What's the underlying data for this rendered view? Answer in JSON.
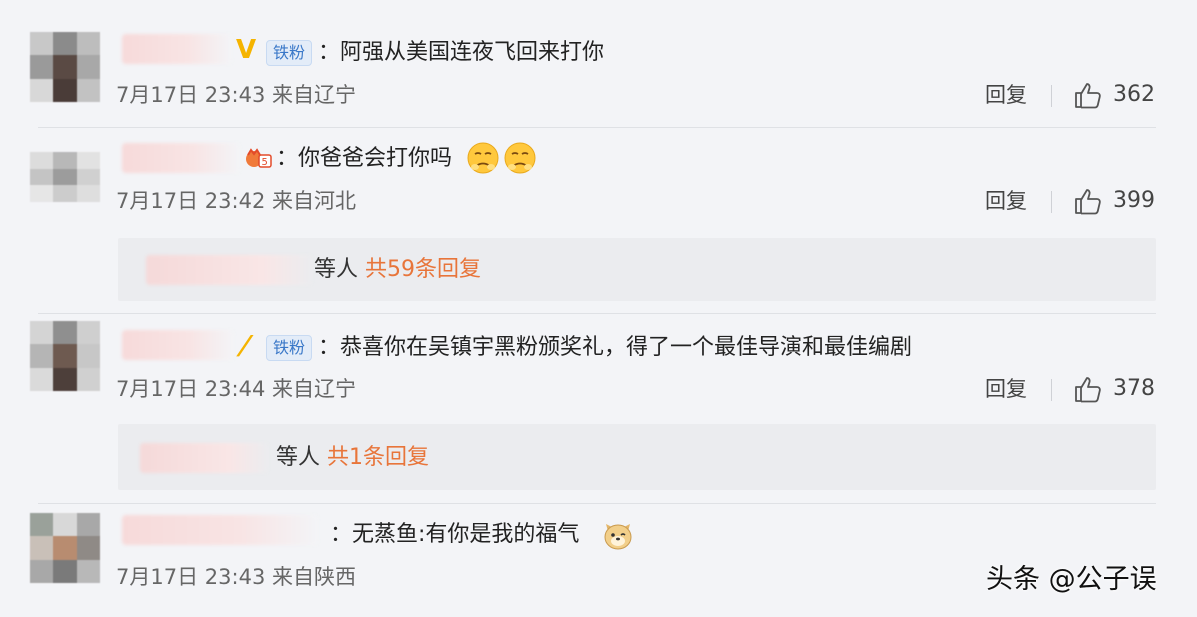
{
  "comments": [
    {
      "badge": "铁粉",
      "text": "：阿强从美国连夜飞回来打你",
      "date": "7月17日",
      "time": "23:43",
      "location": "来自辽宁",
      "reply_label": "回复",
      "likes": "362"
    },
    {
      "text": "：你爸爸会打你吗",
      "emoji": "sad-face-emoji",
      "date": "7月17日",
      "time": "23:42",
      "location": "来自河北",
      "reply_label": "回复",
      "likes": "399",
      "sub_replies": {
        "suffix": "等人",
        "count_text": "共59条回复"
      }
    },
    {
      "badge": "铁粉",
      "text": "：恭喜你在吴镇宇黑粉颁奖礼，得了一个最佳导演和最佳编剧",
      "date": "7月17日",
      "time": "23:44",
      "location": "来自辽宁",
      "reply_label": "回复",
      "likes": "378",
      "sub_replies": {
        "suffix": "等人",
        "count_text": "共1条回复"
      }
    },
    {
      "text": "：无蒸鱼:有你是我的福气",
      "emoji": "dog-face-emoji",
      "date": "7月17日",
      "time": "23:43",
      "location": "来自陕西"
    }
  ],
  "watermark": "头条 @公子误",
  "colors": {
    "background": "#f3f4f7",
    "subreply_count": "#e8753a",
    "badge_text": "#3a78c8",
    "vip_mark": "#f5b400"
  }
}
